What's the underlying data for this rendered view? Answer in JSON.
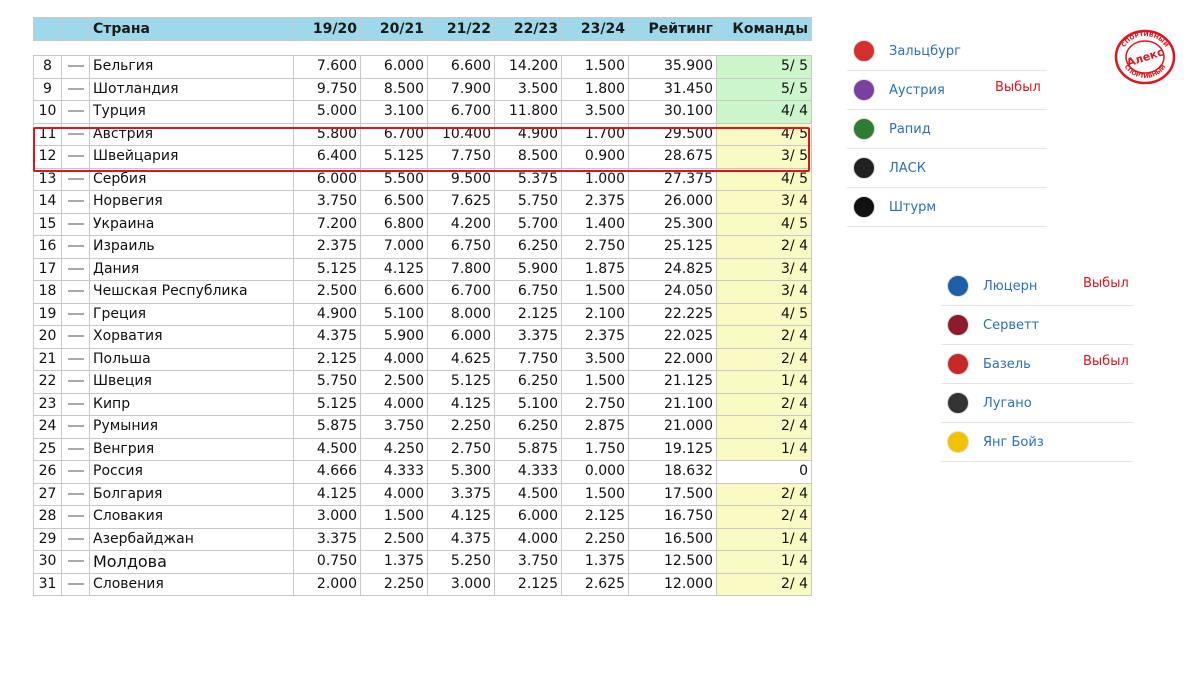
{
  "table": {
    "headers": {
      "rank": "",
      "move": "",
      "country": "Страна",
      "s1": "19/20",
      "s2": "20/21",
      "s3": "21/22",
      "s4": "22/23",
      "s5": "23/24",
      "rating": "Рейтинг",
      "teams": "Команды"
    },
    "rows": [
      {
        "rank": "8",
        "country": "Бельгия",
        "s1": "7.600",
        "s2": "6.000",
        "s3": "6.600",
        "s4": "14.200",
        "s5": "1.500",
        "rating": "35.900",
        "teams": "5/ 5",
        "teams_color": "green"
      },
      {
        "rank": "9",
        "country": "Шотландия",
        "s1": "9.750",
        "s2": "8.500",
        "s3": "7.900",
        "s4": "3.500",
        "s5": "1.800",
        "rating": "31.450",
        "teams": "5/ 5",
        "teams_color": "green"
      },
      {
        "rank": "10",
        "country": "Турция",
        "s1": "5.000",
        "s2": "3.100",
        "s3": "6.700",
        "s4": "11.800",
        "s5": "3.500",
        "rating": "30.100",
        "teams": "4/ 4",
        "teams_color": "green"
      },
      {
        "rank": "11",
        "country": "Австрия",
        "s1": "5.800",
        "s2": "6.700",
        "s3": "10.400",
        "s4": "4.900",
        "s5": "1.700",
        "rating": "29.500",
        "teams": "4/ 5",
        "teams_color": "yellow"
      },
      {
        "rank": "12",
        "country": "Швейцария",
        "s1": "6.400",
        "s2": "5.125",
        "s3": "7.750",
        "s4": "8.500",
        "s5": "0.900",
        "rating": "28.675",
        "teams": "3/ 5",
        "teams_color": "yellow"
      },
      {
        "rank": "13",
        "country": "Сербия",
        "s1": "6.000",
        "s2": "5.500",
        "s3": "9.500",
        "s4": "5.375",
        "s5": "1.000",
        "rating": "27.375",
        "teams": "4/ 5",
        "teams_color": "yellow"
      },
      {
        "rank": "14",
        "country": "Норвегия",
        "s1": "3.750",
        "s2": "6.500",
        "s3": "7.625",
        "s4": "5.750",
        "s5": "2.375",
        "rating": "26.000",
        "teams": "3/ 4",
        "teams_color": "yellow"
      },
      {
        "rank": "15",
        "country": "Украина",
        "s1": "7.200",
        "s2": "6.800",
        "s3": "4.200",
        "s4": "5.700",
        "s5": "1.400",
        "rating": "25.300",
        "teams": "4/ 5",
        "teams_color": "yellow"
      },
      {
        "rank": "16",
        "country": "Израиль",
        "s1": "2.375",
        "s2": "7.000",
        "s3": "6.750",
        "s4": "6.250",
        "s5": "2.750",
        "rating": "25.125",
        "teams": "2/ 4",
        "teams_color": "yellow"
      },
      {
        "rank": "17",
        "country": "Дания",
        "s1": "5.125",
        "s2": "4.125",
        "s3": "7.800",
        "s4": "5.900",
        "s5": "1.875",
        "rating": "24.825",
        "teams": "3/ 4",
        "teams_color": "yellow"
      },
      {
        "rank": "18",
        "country": "Чешская Республика",
        "s1": "2.500",
        "s2": "6.600",
        "s3": "6.700",
        "s4": "6.750",
        "s5": "1.500",
        "rating": "24.050",
        "teams": "3/ 4",
        "teams_color": "yellow"
      },
      {
        "rank": "19",
        "country": "Греция",
        "s1": "4.900",
        "s2": "5.100",
        "s3": "8.000",
        "s4": "2.125",
        "s5": "2.100",
        "rating": "22.225",
        "teams": "4/ 5",
        "teams_color": "yellow"
      },
      {
        "rank": "20",
        "country": "Хорватия",
        "s1": "4.375",
        "s2": "5.900",
        "s3": "6.000",
        "s4": "3.375",
        "s5": "2.375",
        "rating": "22.025",
        "teams": "2/ 4",
        "teams_color": "yellow"
      },
      {
        "rank": "21",
        "country": "Польша",
        "s1": "2.125",
        "s2": "4.000",
        "s3": "4.625",
        "s4": "7.750",
        "s5": "3.500",
        "rating": "22.000",
        "teams": "2/ 4",
        "teams_color": "yellow"
      },
      {
        "rank": "22",
        "country": "Швеция",
        "s1": "5.750",
        "s2": "2.500",
        "s3": "5.125",
        "s4": "6.250",
        "s5": "1.500",
        "rating": "21.125",
        "teams": "1/ 4",
        "teams_color": "yellow"
      },
      {
        "rank": "23",
        "country": "Кипр",
        "s1": "5.125",
        "s2": "4.000",
        "s3": "4.125",
        "s4": "5.100",
        "s5": "2.750",
        "rating": "21.100",
        "teams": "2/ 4",
        "teams_color": "yellow"
      },
      {
        "rank": "24",
        "country": "Румыния",
        "s1": "5.875",
        "s2": "3.750",
        "s3": "2.250",
        "s4": "6.250",
        "s5": "2.875",
        "rating": "21.000",
        "teams": "2/ 4",
        "teams_color": "yellow"
      },
      {
        "rank": "25",
        "country": "Венгрия",
        "s1": "4.500",
        "s2": "4.250",
        "s3": "2.750",
        "s4": "5.875",
        "s5": "1.750",
        "rating": "19.125",
        "teams": "1/ 4",
        "teams_color": "yellow"
      },
      {
        "rank": "26",
        "country": "Россия",
        "s1": "4.666",
        "s2": "4.333",
        "s3": "5.300",
        "s4": "4.333",
        "s5": "0.000",
        "rating": "18.632",
        "teams": "0",
        "teams_color": "white"
      },
      {
        "rank": "27",
        "country": "Болгария",
        "s1": "4.125",
        "s2": "4.000",
        "s3": "3.375",
        "s4": "4.500",
        "s5": "1.500",
        "rating": "17.500",
        "teams": "2/ 4",
        "teams_color": "yellow"
      },
      {
        "rank": "28",
        "country": "Словакия",
        "s1": "3.000",
        "s2": "1.500",
        "s3": "4.125",
        "s4": "6.000",
        "s5": "2.125",
        "rating": "16.750",
        "teams": "2/ 4",
        "teams_color": "yellow"
      },
      {
        "rank": "29",
        "country": "Азербайджан",
        "s1": "3.375",
        "s2": "2.500",
        "s3": "4.375",
        "s4": "4.000",
        "s5": "2.250",
        "rating": "16.500",
        "teams": "1/ 4",
        "teams_color": "yellow"
      },
      {
        "rank": "30",
        "country": "Молдова",
        "s1": "0.750",
        "s2": "1.375",
        "s3": "5.250",
        "s4": "3.750",
        "s5": "1.375",
        "rating": "12.500",
        "teams": "1/ 4",
        "teams_color": "yellow"
      },
      {
        "rank": "31",
        "country": "Словения",
        "s1": "2.000",
        "s2": "2.250",
        "s3": "3.000",
        "s4": "2.125",
        "s5": "2.625",
        "rating": "12.000",
        "teams": "2/ 4",
        "teams_color": "yellow"
      }
    ]
  },
  "austria_clubs": [
    {
      "name": "Зальцбург",
      "status": "",
      "icon": "salzburg-icon",
      "color": "#d32f2f"
    },
    {
      "name": "Аустрия",
      "status": "Выбыл",
      "icon": "austria-wien-icon",
      "color": "#7b3fa0"
    },
    {
      "name": "Рапид",
      "status": "",
      "icon": "rapid-icon",
      "color": "#2e7d32"
    },
    {
      "name": "ЛАСК",
      "status": "",
      "icon": "lask-icon",
      "color": "#222222"
    },
    {
      "name": "Штурм",
      "status": "",
      "icon": "sturm-icon",
      "color": "#111111"
    }
  ],
  "swiss_clubs": [
    {
      "name": "Люцерн",
      "status": "Выбыл",
      "icon": "luzern-icon",
      "color": "#1f5fa8"
    },
    {
      "name": "Серветт",
      "status": "",
      "icon": "servette-icon",
      "color": "#8e1b2b"
    },
    {
      "name": "Базель",
      "status": "Выбыл",
      "icon": "basel-icon",
      "color": "#c62828"
    },
    {
      "name": "Лугано",
      "status": "",
      "icon": "lugano-icon",
      "color": "#333333"
    },
    {
      "name": "Янг Бойз",
      "status": "",
      "icon": "young-boys-icon",
      "color": "#f2c200"
    }
  ],
  "logo": {
    "text_top": "СПОРТИВНЫЙ",
    "text_middle": "Алекс",
    "text_bottom": "СПОРТИВНЫЙ",
    "color": "#e0141e"
  },
  "colors": {
    "header": "#9fd8ea",
    "teams_green": "#ccf5cc",
    "teams_yellow": "#fafac4",
    "highlight": "#e0141e",
    "link": "#2b6fbd",
    "status": "#e0141e"
  }
}
